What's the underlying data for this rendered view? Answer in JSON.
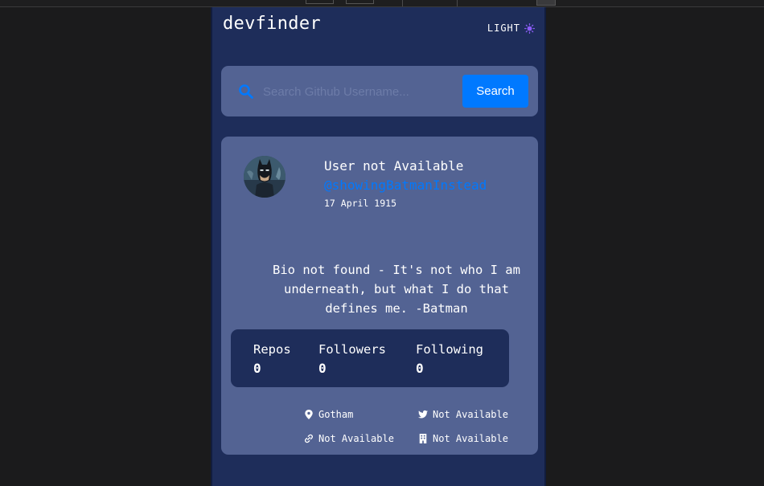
{
  "app": {
    "logo": "devfinder",
    "theme_label": "LIGHT",
    "accent": "#0079ff",
    "theme_icon": "sun-icon"
  },
  "search": {
    "placeholder": "Search Github Username...",
    "value": "",
    "button_label": "Search"
  },
  "profile": {
    "name": "User not Available",
    "login": "@showingBatmanInstead",
    "joined": "17 April 1915",
    "bio": "Bio not found - It's not who I am underneath, but what I do that defines me. -Batman",
    "avatar_icon": "batman-avatar",
    "stats": [
      {
        "label": "Repos",
        "value": "0"
      },
      {
        "label": "Followers",
        "value": "0"
      },
      {
        "label": "Following",
        "value": "0"
      }
    ],
    "links": {
      "location": "Gotham",
      "twitter": "Not Available",
      "blog": "Not Available",
      "company": "Not Available"
    }
  }
}
